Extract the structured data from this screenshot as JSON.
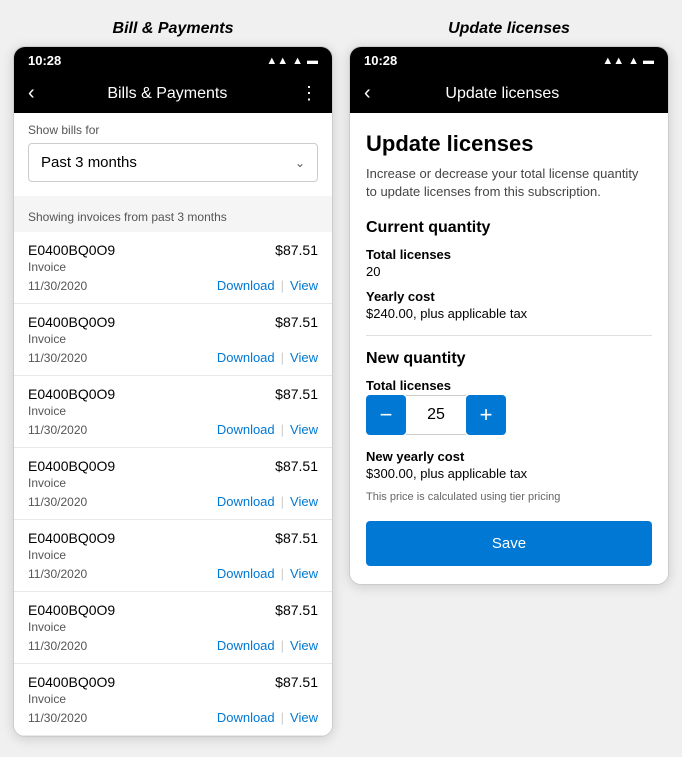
{
  "left": {
    "title": "Bill & Payments",
    "statusBar": {
      "time": "10:28",
      "icons": "▲▲ ▲ ▬"
    },
    "navBar": {
      "title": "Bills & Payments"
    },
    "filter": {
      "label": "Show bills for",
      "selected": "Past 3 months"
    },
    "showing": "Showing invoices from past 3 months",
    "invoices": [
      {
        "id": "E0400BQ0O9",
        "amount": "$87.51",
        "type": "Invoice",
        "date": "11/30/2020"
      },
      {
        "id": "E0400BQ0O9",
        "amount": "$87.51",
        "type": "Invoice",
        "date": "11/30/2020"
      },
      {
        "id": "E0400BQ0O9",
        "amount": "$87.51",
        "type": "Invoice",
        "date": "11/30/2020"
      },
      {
        "id": "E0400BQ0O9",
        "amount": "$87.51",
        "type": "Invoice",
        "date": "11/30/2020"
      },
      {
        "id": "E0400BQ0O9",
        "amount": "$87.51",
        "type": "Invoice",
        "date": "11/30/2020"
      },
      {
        "id": "E0400BQ0O9",
        "amount": "$87.51",
        "type": "Invoice",
        "date": "11/30/2020"
      },
      {
        "id": "E0400BQ0O9",
        "amount": "$87.51",
        "type": "Invoice",
        "date": "11/30/2020"
      }
    ],
    "downloadLabel": "Download",
    "viewLabel": "View"
  },
  "right": {
    "title": "Update licenses",
    "statusBar": {
      "time": "10:28"
    },
    "navBar": {
      "title": "Update licenses"
    },
    "heading": "Update licenses",
    "description": "Increase or decrease your total license quantity to update licenses from this subscription.",
    "currentSection": "Current quantity",
    "totalLicensesLabel": "Total licenses",
    "totalLicensesValue": "20",
    "yearlyCostLabel": "Yearly cost",
    "yearlyCostValue": "$240.00, plus applicable tax",
    "newSection": "New quantity",
    "newTotalLicensesLabel": "Total licenses",
    "quantityValue": "25",
    "newYearlyCostLabel": "New yearly cost",
    "newYearlyCostValue": "$300.00, plus applicable tax",
    "pricingNote": "This price is calculated using tier pricing",
    "saveLabel": "Save",
    "decreaseLabel": "−",
    "increaseLabel": "+"
  }
}
